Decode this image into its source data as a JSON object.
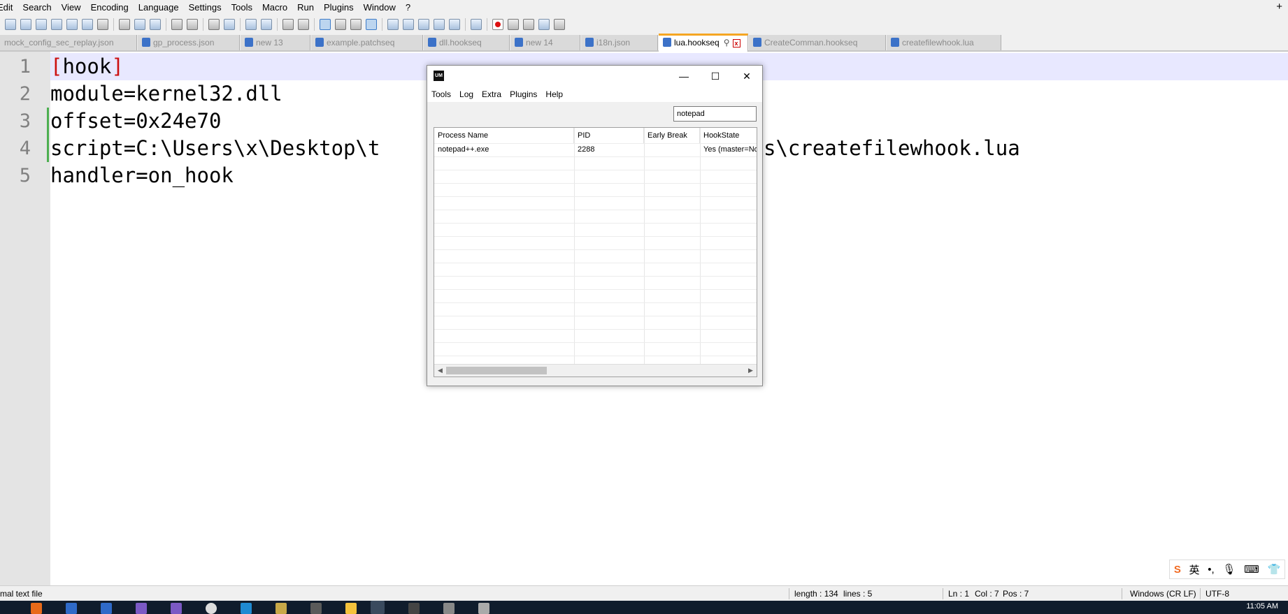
{
  "menubar": {
    "items": [
      "Edit",
      "Search",
      "View",
      "Encoding",
      "Language",
      "Settings",
      "Tools",
      "Macro",
      "Run",
      "Plugins",
      "Window",
      "?"
    ],
    "plus": "+"
  },
  "tabs": [
    {
      "label": "mock_config_sec_replay.json"
    },
    {
      "label": "gp_process.json"
    },
    {
      "label": "new 13"
    },
    {
      "label": "example.patchseq"
    },
    {
      "label": "dll.hookseq"
    },
    {
      "label": "new 14"
    },
    {
      "label": "i18n.json"
    },
    {
      "label": "lua.hookseq",
      "active": true
    },
    {
      "label": "CreateComman.hookseq"
    },
    {
      "label": "createfilewhook.lua"
    }
  ],
  "editor": {
    "line_numbers": [
      "1",
      "2",
      "3",
      "4",
      "5"
    ],
    "lines": [
      {
        "open": "[",
        "text": "hook",
        "close": "]"
      },
      {
        "text": "module=kernel32.dll"
      },
      {
        "text": "offset=0x24e70"
      },
      {
        "text": "script=C:\\Users\\x\\Desktop\\t",
        "tail": "s\\createfilewhook.lua"
      },
      {
        "text": "handler=on_hook"
      }
    ]
  },
  "dialog": {
    "logo": "UM",
    "controls": {
      "minimize": "—",
      "maximize": "☐",
      "close": "✕"
    },
    "menu": [
      "Tools",
      "Log",
      "Extra",
      "Plugins",
      "Help"
    ],
    "search_value": "notepad",
    "columns": [
      "Process Name",
      "PID",
      "Early Break",
      "HookState"
    ],
    "rows": [
      {
        "process": "notepad++.exe",
        "pid": "2288",
        "early_break": "",
        "hook_state": "Yes (master=No"
      }
    ]
  },
  "status": {
    "file_type": "mal text file",
    "length": "length : 134",
    "lines": "lines : 5",
    "ln": "Ln : 1",
    "col": "Col : 7",
    "pos": "Pos : 7",
    "eol": "Windows (CR LF)",
    "encoding": "UTF-8"
  },
  "ime": {
    "sogou": "S",
    "lang": "英",
    "punct": "•,",
    "mic": "🎙",
    "kb": "⌨",
    "extra": "👕"
  },
  "taskbar": {
    "clock": "11:05 AM"
  },
  "colors": {
    "accent_tab": "#f5a623",
    "bracket": "#cc1010",
    "fold": "#4caf50"
  }
}
